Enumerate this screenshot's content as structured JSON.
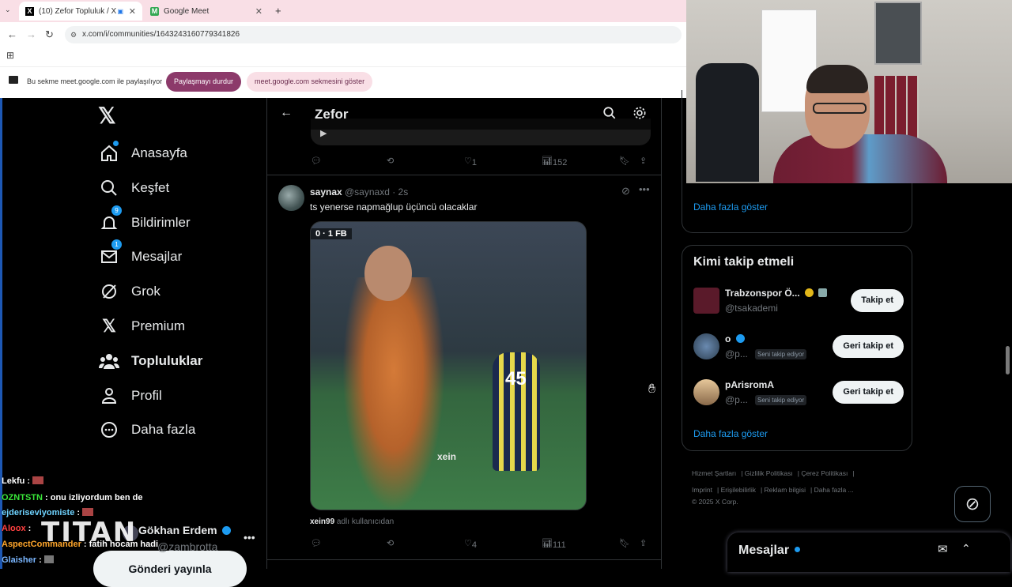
{
  "browser": {
    "tabs": [
      {
        "title": "(10) Zefor Topluluk / X",
        "favicon": "X"
      },
      {
        "title": "Google Meet",
        "favicon": "M"
      }
    ],
    "new_tab": "+",
    "url": "x.com/i/communities/1643243160779341826",
    "share_bar": {
      "text": "Bu sekme meet.google.com ile paylaşılıyor",
      "stop_label": "Paylaşmayı durdur",
      "show_label": "meet.google.com sekmesini göster"
    }
  },
  "nav": {
    "items": [
      {
        "label": "Anasayfa",
        "icon": "home-icon"
      },
      {
        "label": "Keşfet",
        "icon": "search-icon"
      },
      {
        "label": "Bildirimler",
        "icon": "bell-icon",
        "badge": "9"
      },
      {
        "label": "Mesajlar",
        "icon": "mail-icon",
        "badge": "1"
      },
      {
        "label": "Grok",
        "icon": "grok-icon"
      },
      {
        "label": "Premium",
        "icon": "x-logo-icon"
      },
      {
        "label": "Topluluklar",
        "icon": "communities-icon"
      },
      {
        "label": "Profil",
        "icon": "user-icon"
      },
      {
        "label": "Daha fazla",
        "icon": "more-circle-icon"
      }
    ],
    "post_button": "Gönderi yayınla",
    "profile_name": "Gökhan Erdem",
    "profile_handle": "@zambrotta",
    "profile_more": "•••"
  },
  "community": {
    "title": "Zefor",
    "prev_tweet_stats": {
      "reply": "",
      "retweet": "",
      "likes": "1",
      "views": "152"
    },
    "tweet": {
      "name": "saynax",
      "handle_time": "@saynaxd · 2s",
      "text": "ts yenerse napmağlup üçüncü olacaklar",
      "media_score": "0 · 1   FB",
      "media_jersey": "45",
      "media_watermark": "xein",
      "credit_user": "xein99",
      "credit_text": "adlı kullanıcıdan",
      "stats": {
        "reply": "",
        "retweet": "",
        "likes": "4",
        "views": "111"
      }
    }
  },
  "sidebar": {
    "prev_card_show_more": "Daha fazla göster",
    "who_to_follow": {
      "title": "Kimi takip etmeli",
      "users": [
        {
          "name": "Trabzonspor Ö...",
          "handle": "@tsakademi",
          "follows_you": "",
          "button": "Takip et"
        },
        {
          "name": "o",
          "handle": "@p...",
          "follows_you": "Seni takip ediyor",
          "button": "Geri takip et"
        },
        {
          "name": "pArisromA",
          "handle": "@p...",
          "follows_you": "Seni takip ediyor",
          "button": "Geri takip et"
        }
      ],
      "show_more": "Daha fazla göster"
    },
    "footer": [
      "Hizmet Şartları",
      "Gizlilik Politikası",
      "Çerez Politikası",
      "Imprint",
      "Erişilebilirlik",
      "Reklam bilgisi",
      "Daha fazla ...",
      "© 2025 X Corp."
    ],
    "messages_drawer": "Mesajlar"
  },
  "stream": {
    "logo": "TITAN",
    "chat": [
      {
        "user": "Lekfu",
        "msg": ":",
        "color": "#ffffff"
      },
      {
        "user": "OZNTSTN",
        "msg": ": onu izliyordum ben de",
        "color": "#39e639"
      },
      {
        "user": "ejderiseviyomiste",
        "msg": ":",
        "color": "#6fd3ff"
      },
      {
        "user": "Aloox",
        "msg": ":",
        "color": "#ff4040"
      },
      {
        "user": "AspectCommander",
        "msg": ": fatih hocam hadi",
        "color": "#ffa62b"
      },
      {
        "user": "Glaisher",
        "msg": ":",
        "color": "#7ab6ff"
      }
    ]
  }
}
